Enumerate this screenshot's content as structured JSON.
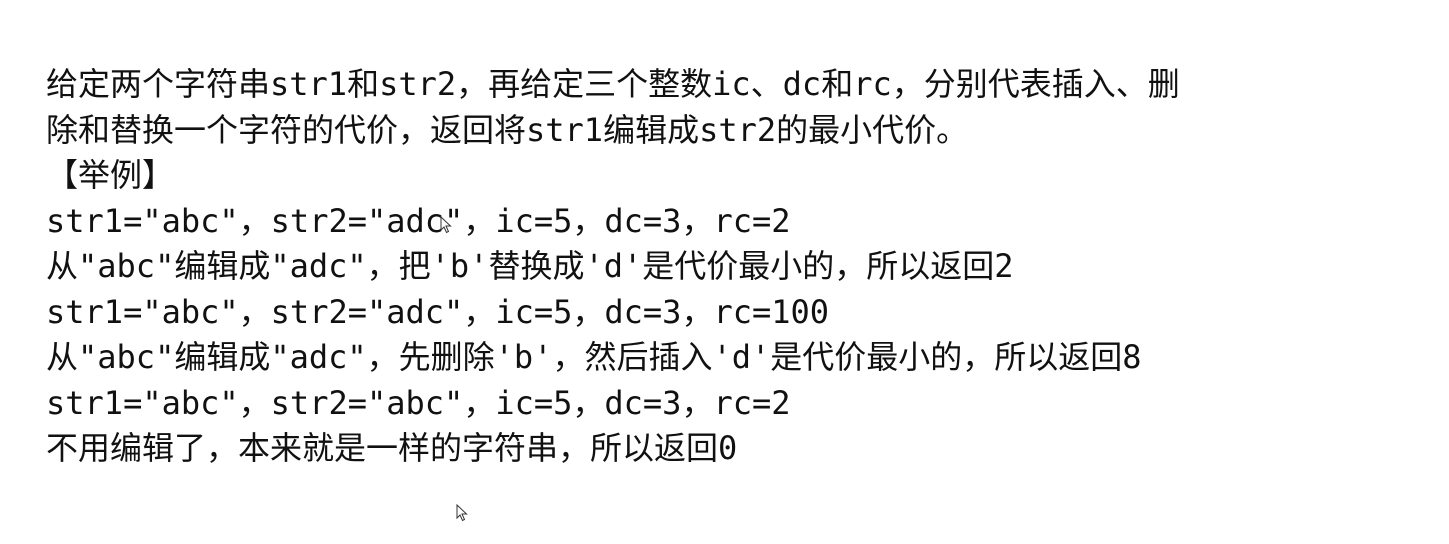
{
  "problem": {
    "lines": [
      "给定两个字符串str1和str2，再给定三个整数ic、dc和rc，分别代表插入、删",
      "除和替换一个字符的代价，返回将str1编辑成str2的最小代价。",
      "【举例】",
      "str1=\"abc\"，str2=\"adc\"，ic=5，dc=3，rc=2",
      "从\"abc\"编辑成\"adc\"，把'b'替换成'd'是代价最小的，所以返回2",
      "str1=\"abc\"，str2=\"adc\"，ic=5，dc=3，rc=100",
      "从\"abc\"编辑成\"adc\"，先删除'b'，然后插入'd'是代价最小的，所以返回8",
      "str1=\"abc\"，str2=\"abc\"，ic=5，dc=3，rc=2",
      "不用编辑了，本来就是一样的字符串，所以返回0"
    ]
  },
  "icons": {
    "cursor": "mouse-pointer-icon"
  },
  "colors": {
    "text": "#111111",
    "background": "#ffffff"
  }
}
